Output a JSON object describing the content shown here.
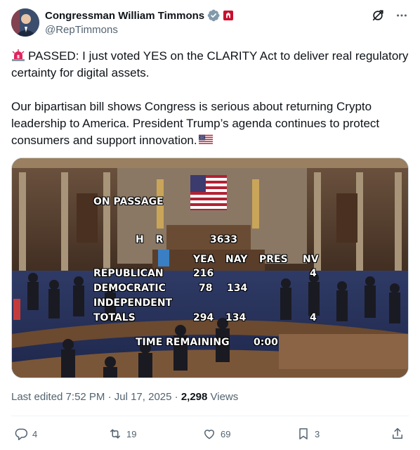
{
  "author": {
    "name": "Congressman William Timmons",
    "handle": "@RepTimmons"
  },
  "post": {
    "paragraph1": "PASSED: I just voted YES on the CLARITY Act to deliver real regulatory certainty for digital assets.",
    "paragraph2": "Our bipartisan bill shows Congress is serious about returning Crypto leadership to America. President Trump’s agenda continues to protect consumers and support innovation."
  },
  "media": {
    "overlay": {
      "heading": "ON PASSAGE",
      "bill_label": "H R",
      "bill_number": "3633",
      "columns": [
        "YEA",
        "NAY",
        "PRES",
        "NV"
      ],
      "rows": [
        {
          "party": "REPUBLICAN",
          "yea": "216",
          "nay": "",
          "pres": "",
          "nv": "4"
        },
        {
          "party": "DEMOCRATIC",
          "yea": "78",
          "nay": "134",
          "pres": "",
          "nv": ""
        },
        {
          "party": "INDEPENDENT",
          "yea": "",
          "nay": "",
          "pres": "",
          "nv": ""
        },
        {
          "party": "TOTALS",
          "yea": "294",
          "nay": "134",
          "pres": "",
          "nv": "4"
        }
      ],
      "time_label": "TIME REMAINING",
      "time_value": "0:00"
    }
  },
  "meta": {
    "edited": "Last edited 7:52 PM · Jul 17, 2025 · ",
    "views_count": "2,298",
    "views_label": " Views"
  },
  "actions": {
    "replies": "4",
    "reposts": "19",
    "likes": "69",
    "bookmarks": "3"
  },
  "colors": {
    "text": "#0f1419",
    "secondary": "#536471",
    "verified": "#829aab",
    "siren": "#e0245e"
  }
}
